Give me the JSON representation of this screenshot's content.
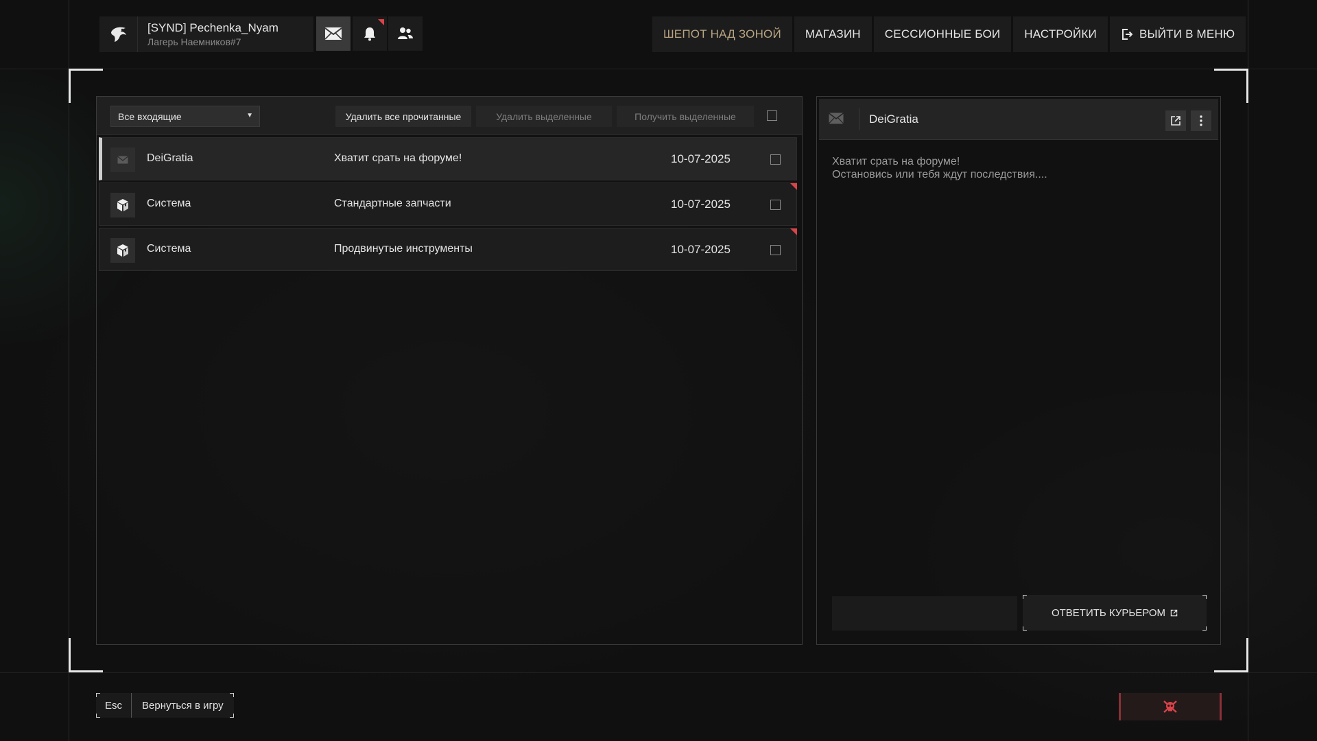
{
  "user": {
    "name": "[SYND] Pechenka_Nyam",
    "subtitle": "Лагерь Наемников#7"
  },
  "top_icons": [
    {
      "name": "mail-icon",
      "active": true
    },
    {
      "name": "bell-icon",
      "has_notification": true
    },
    {
      "name": "friends-icon"
    }
  ],
  "nav": {
    "items": [
      {
        "label": "ШЕПОТ НАД ЗОНОЙ",
        "active": true
      },
      {
        "label": "МАГАЗИН"
      },
      {
        "label": "СЕССИОННЫЕ БОИ"
      },
      {
        "label": "НАСТРОЙКИ"
      },
      {
        "label": "ВЫЙТИ В МЕНЮ",
        "icon": "exit-icon"
      }
    ]
  },
  "inbox": {
    "filter_value": "Все входящие",
    "buttons": {
      "delete_read": "Удалить все прочитанные",
      "delete_selected": "Удалить выделенные",
      "receive_selected": "Получить выделенные"
    },
    "messages": [
      {
        "sender": "DeiGratia",
        "subject": "Хватит срать на форуме!",
        "date": "10-07-2025",
        "icon": "mail-icon",
        "selected": true,
        "unread": false
      },
      {
        "sender": "Система",
        "subject": "Стандартные запчасти",
        "date": "10-07-2025",
        "icon": "package-icon",
        "selected": false,
        "unread": true
      },
      {
        "sender": "Система",
        "subject": "Продвинутые инструменты",
        "date": "10-07-2025",
        "icon": "package-icon",
        "selected": false,
        "unread": true
      }
    ]
  },
  "reader": {
    "from": "DeiGratia",
    "body_line1": "Хватит срать на форуме!",
    "body_line2": "Остановись или тебя ждут последствия....",
    "reply_button": "ОТВЕТИТЬ КУРЬЕРОМ"
  },
  "footer": {
    "esc_key": "Esc",
    "esc_label": "Вернуться в игру"
  },
  "colors": {
    "accent_gold": "#b9a582",
    "notification_red": "#d9434a"
  }
}
